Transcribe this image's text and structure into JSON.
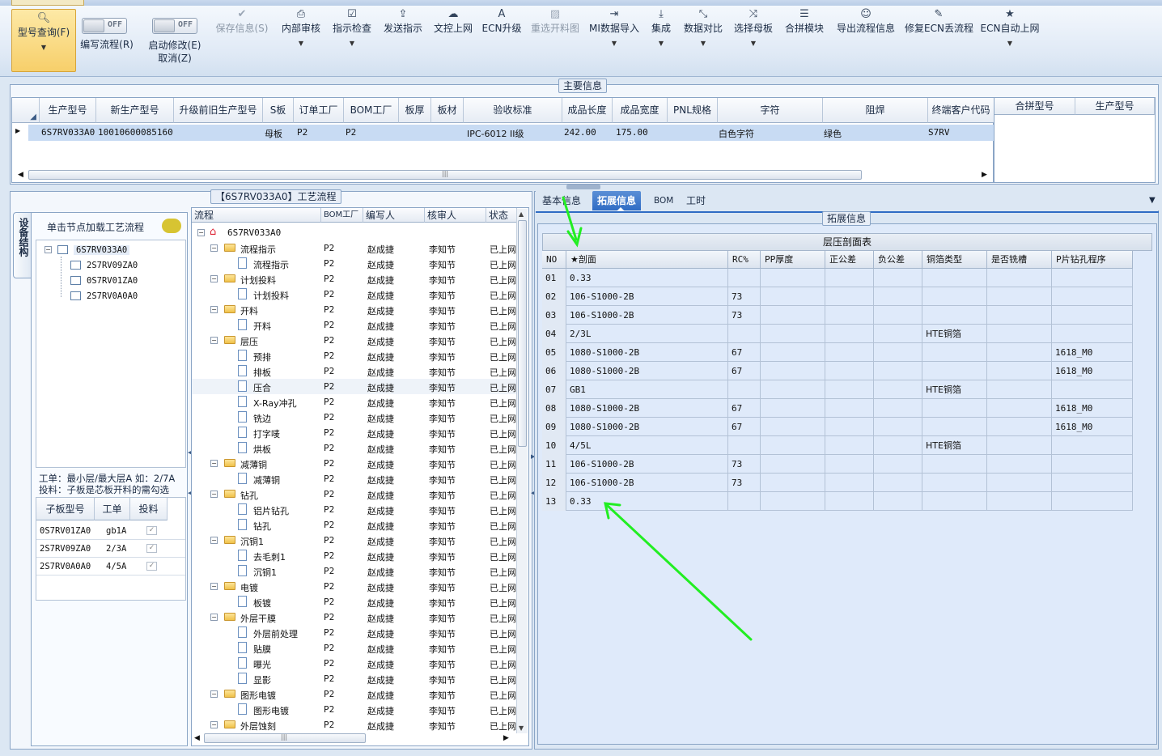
{
  "toolbar": {
    "query": "型号查询(F)",
    "edit_flow": "编写流程(R)",
    "start_modify": "启动修改(E)",
    "cancel": "取消(Z)",
    "toggle_off": "OFF",
    "items": [
      {
        "label": "保存信息(S)",
        "icon": "✔"
      },
      {
        "label": "内部审核",
        "icon": "⎙"
      },
      {
        "label": "指示检查",
        "icon": "☑"
      },
      {
        "label": "发送指示",
        "icon": "⇪"
      },
      {
        "label": "文控上网",
        "icon": "☁"
      },
      {
        "label": "ECN升级",
        "icon": "A"
      },
      {
        "label": "重选开料图",
        "icon": "▨"
      },
      {
        "label": "MI数据导入",
        "icon": "⇥"
      },
      {
        "label": "集成",
        "icon": "⤓"
      },
      {
        "label": "数据对比",
        "icon": "⤡"
      },
      {
        "label": "选择母板",
        "icon": "⤨"
      },
      {
        "label": "合拼模块",
        "icon": "☰"
      },
      {
        "label": "导出流程信息",
        "icon": "☺"
      },
      {
        "label": "修复ECN丢流程",
        "icon": "✎"
      },
      {
        "label": "ECN自动上网",
        "icon": "★"
      }
    ]
  },
  "main_info": {
    "title": "主要信息",
    "columns": [
      "生产型号",
      "新生产型号",
      "升级前旧生产型号",
      "S板",
      "订单工厂",
      "BOM工厂",
      "板厚",
      "板材",
      "验收标准",
      "成品长度",
      "成品宽度",
      "PNL规格",
      "字符",
      "阻焊",
      "终端客户代码"
    ],
    "row": {
      "model": "6S7RV033A0",
      "new_model": "10010600085160",
      "s_board": "母板",
      "order_factory": "P2",
      "bom_factory": "P2",
      "standard": "IPC-6012 II级",
      "length": "242.00",
      "width": "175.00",
      "char": "白色字符",
      "solder": "绿色",
      "customer": "S7RV"
    },
    "merge_columns": [
      "合拼型号",
      "生产型号"
    ]
  },
  "left_panel": {
    "side_tab": "设备结构",
    "hint": "单击节点加载工艺流程",
    "tree_root": "6S7RV033A0",
    "tree_children": [
      "2S7RV09ZA0",
      "0S7RV01ZA0",
      "2S7RV0A0A0"
    ],
    "note1": "工单：最小层/最大层A 如：2/7A",
    "note2": "投料：子板是芯板开料的需勾选",
    "sub_columns": [
      "子板型号",
      "工单",
      "投料"
    ],
    "sub_rows": [
      {
        "model": "0S7RV01ZA0",
        "order": "gb1A"
      },
      {
        "model": "2S7RV09ZA0",
        "order": "2/3A"
      },
      {
        "model": "2S7RV0A0A0",
        "order": "4/5A"
      }
    ]
  },
  "process": {
    "title": "【6S7RV033A0】工艺流程",
    "columns": [
      "流程",
      "BOM工厂",
      "编写人",
      "核审人",
      "状态"
    ],
    "root": "6S7RV033A0",
    "factory": "P2",
    "writer": "赵成捷",
    "reviewer": "李知节",
    "status": "已上网",
    "rows": [
      {
        "name": "流程指示",
        "level": 1
      },
      {
        "name": "流程指示",
        "level": 2
      },
      {
        "name": "计划投料",
        "level": 1
      },
      {
        "name": "计划投料",
        "level": 2
      },
      {
        "name": "开料",
        "level": 1
      },
      {
        "name": "开料",
        "level": 2
      },
      {
        "name": "层压",
        "level": 1
      },
      {
        "name": "预排",
        "level": 2
      },
      {
        "name": "排板",
        "level": 2
      },
      {
        "name": "压合",
        "level": 2
      },
      {
        "name": "X-Ray冲孔",
        "level": 2
      },
      {
        "name": "铣边",
        "level": 2
      },
      {
        "name": "打字唛",
        "level": 2
      },
      {
        "name": "烘板",
        "level": 2
      },
      {
        "name": "减薄铜",
        "level": 1
      },
      {
        "name": "减薄铜",
        "level": 2
      },
      {
        "name": "钻孔",
        "level": 1
      },
      {
        "name": "铝片钻孔",
        "level": 2
      },
      {
        "name": "钻孔",
        "level": 2
      },
      {
        "name": "沉铜1",
        "level": 1
      },
      {
        "name": "去毛刺1",
        "level": 2
      },
      {
        "name": "沉铜1",
        "level": 2
      },
      {
        "name": "电镀",
        "level": 1
      },
      {
        "name": "板镀",
        "level": 2
      },
      {
        "name": "外层干膜",
        "level": 1
      },
      {
        "name": "外层前处理",
        "level": 2
      },
      {
        "name": "贴膜",
        "level": 2
      },
      {
        "name": "曝光",
        "level": 2
      },
      {
        "name": "显影",
        "level": 2
      },
      {
        "name": "图形电镀",
        "level": 1
      },
      {
        "name": "图形电镀",
        "level": 2
      },
      {
        "name": "外层蚀刻",
        "level": 1
      }
    ]
  },
  "right_panel": {
    "tabs": [
      "基本信息",
      "拓展信息",
      "BOM",
      "工时"
    ],
    "active_tab": "拓展信息",
    "section_title": "拓展信息",
    "table_title": "层压剖面表",
    "columns": [
      "NO",
      "★剖面",
      "RC%",
      "PP厚度",
      "正公差",
      "负公差",
      "铜箔类型",
      "是否铣槽",
      "P片钻孔程序"
    ],
    "rows": [
      {
        "no": "01",
        "section": "0.33",
        "rc": "",
        "copper": "",
        "drill": ""
      },
      {
        "no": "02",
        "section": "106-S1000-2B",
        "rc": "73",
        "copper": "",
        "drill": ""
      },
      {
        "no": "03",
        "section": "106-S1000-2B",
        "rc": "73",
        "copper": "",
        "drill": ""
      },
      {
        "no": "04",
        "section": "2/3L",
        "rc": "",
        "copper": "HTE铜箔",
        "drill": ""
      },
      {
        "no": "05",
        "section": "1080-S1000-2B",
        "rc": "67",
        "copper": "",
        "drill": "1618_M0"
      },
      {
        "no": "06",
        "section": "1080-S1000-2B",
        "rc": "67",
        "copper": "",
        "drill": "1618_M0"
      },
      {
        "no": "07",
        "section": "GB1",
        "rc": "",
        "copper": "HTE铜箔",
        "drill": ""
      },
      {
        "no": "08",
        "section": "1080-S1000-2B",
        "rc": "67",
        "copper": "",
        "drill": "1618_M0"
      },
      {
        "no": "09",
        "section": "1080-S1000-2B",
        "rc": "67",
        "copper": "",
        "drill": "1618_M0"
      },
      {
        "no": "10",
        "section": "4/5L",
        "rc": "",
        "copper": "HTE铜箔",
        "drill": ""
      },
      {
        "no": "11",
        "section": "106-S1000-2B",
        "rc": "73",
        "copper": "",
        "drill": ""
      },
      {
        "no": "12",
        "section": "106-S1000-2B",
        "rc": "73",
        "copper": "",
        "drill": ""
      },
      {
        "no": "13",
        "section": "0.33",
        "rc": "",
        "copper": "",
        "drill": ""
      }
    ]
  },
  "colors": {
    "selection": "#c8dbf3",
    "active_tab": "#2f6cc4",
    "annotation_arrow": "#22ee22",
    "query_button": "#f7cf6a"
  }
}
